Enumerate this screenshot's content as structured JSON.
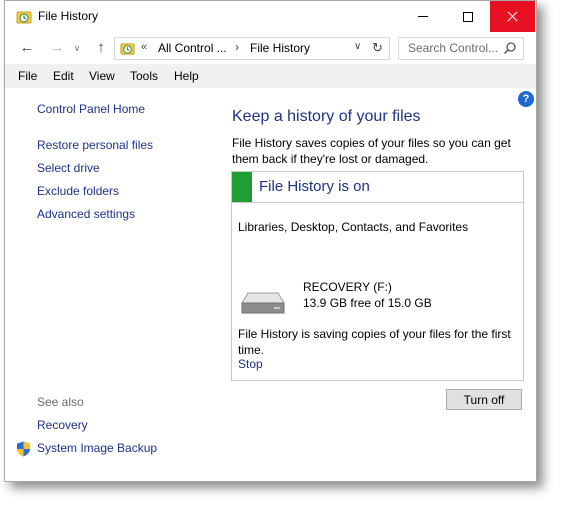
{
  "window": {
    "title": "File History"
  },
  "nav": {
    "address_segments": [
      "All Control ...",
      "File History"
    ],
    "address_overflow": "«",
    "search_placeholder": "Search Control..."
  },
  "menu": [
    "File",
    "Edit",
    "View",
    "Tools",
    "Help"
  ],
  "left_pane": {
    "home_link": "Control Panel Home",
    "links": [
      "Restore personal files",
      "Select drive",
      "Exclude folders",
      "Advanced settings"
    ],
    "see_also_label": "See also",
    "see_also_links": [
      "Recovery",
      "System Image Backup"
    ]
  },
  "main": {
    "heading": "Keep a history of your files",
    "description": "File History saves copies of your files so you can get them back if they're lost or damaged.",
    "status": "File History is on",
    "status_color": "#1e9e33",
    "libraries": "Libraries, Desktop, Contacts, and Favorites",
    "drive_name": "RECOVERY (F:)",
    "drive_free": "13.9 GB free of 15.0 GB",
    "saving_message": "File History is saving copies of your files for the first time.",
    "stop_link": "Stop",
    "turn_off_button": "Turn off",
    "help": "?"
  },
  "colors": {
    "link": "#1e3287",
    "close_button": "#e81123",
    "menu_bar": "#f0f0f0"
  }
}
